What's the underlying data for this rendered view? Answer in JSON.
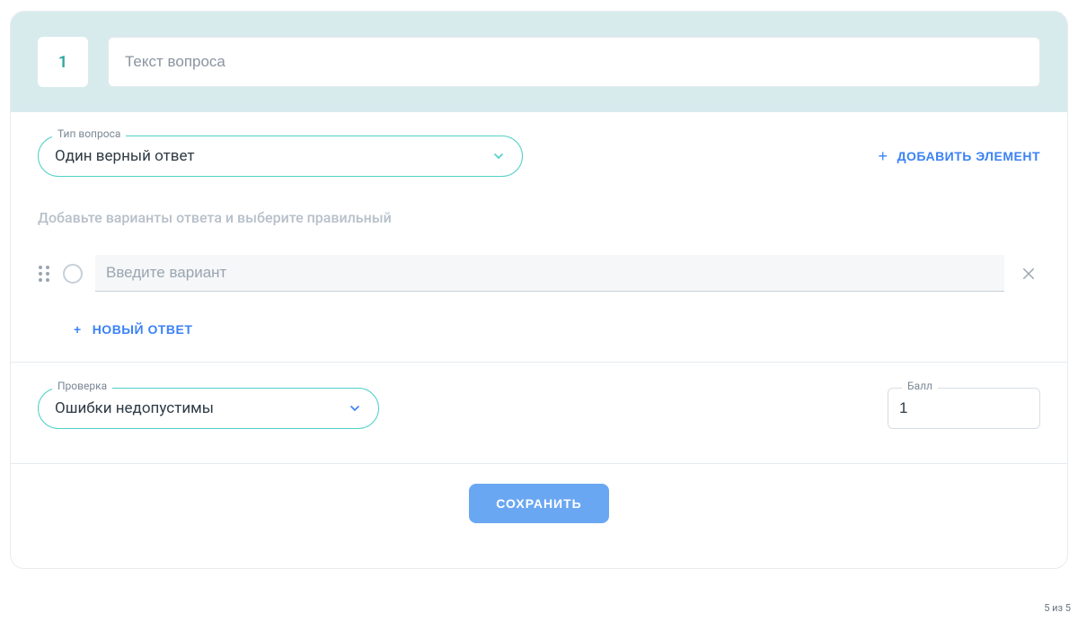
{
  "question_number": "1",
  "question_placeholder": "Текст вопроса",
  "type_label": "Тип вопроса",
  "type_value": "Один верный ответ",
  "add_element_label": "ДОБАВИТЬ ЭЛЕМЕНТ",
  "answers_hint": "Добавьте варианты ответа и выберите правильный",
  "variant_placeholder": "Введите вариант",
  "new_answer_label": "НОВЫЙ ОТВЕТ",
  "check_label": "Проверка",
  "check_value": "Ошибки недопустимы",
  "score_label": "Балл",
  "score_value": "1",
  "save_label": "СОХРАНИТЬ",
  "pager": "5 из 5"
}
